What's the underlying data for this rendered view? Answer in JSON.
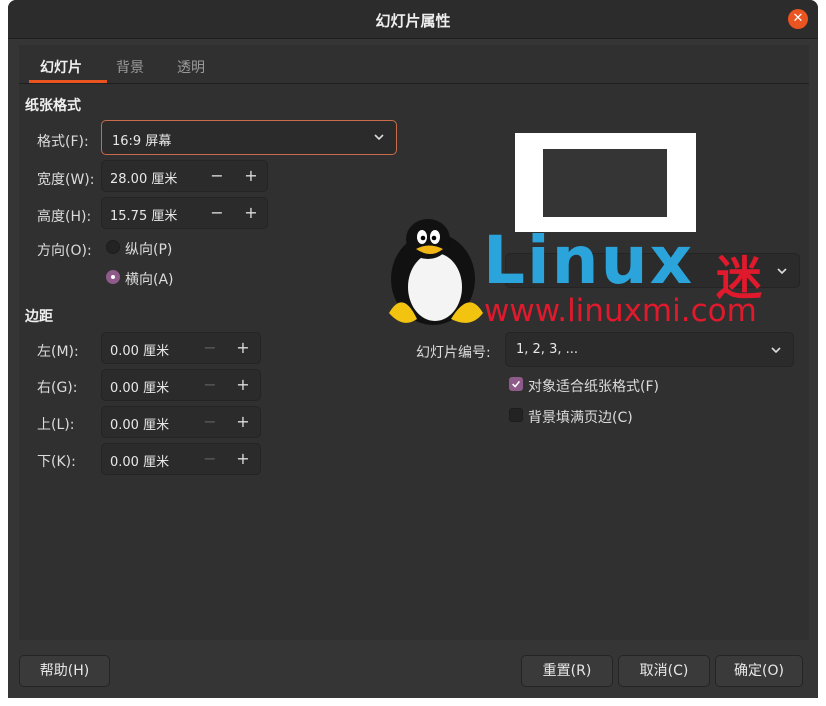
{
  "window": {
    "title": "幻灯片属性"
  },
  "tabs": [
    {
      "label": "幻灯片",
      "active": true
    },
    {
      "label": "背景",
      "active": false
    },
    {
      "label": "透明",
      "active": false
    }
  ],
  "paper_format": {
    "section_label": "纸张格式",
    "format_label": "格式(F):",
    "format_value": "16:9 屏幕",
    "width_label": "宽度(W):",
    "width_value": "28.00 厘米",
    "height_label": "高度(H):",
    "height_value": "15.75 厘米",
    "orientation_label": "方向(O):",
    "portrait_label": "纵向(P)",
    "landscape_label": "横向(A)",
    "orientation_selected": "landscape"
  },
  "margins": {
    "section_label": "边距",
    "left_label": "左(M):",
    "left_value": "0.00 厘米",
    "right_label": "右(G):",
    "right_value": "0.00 厘米",
    "top_label": "上(L):",
    "top_value": "0.00 厘米",
    "bottom_label": "下(K):",
    "bottom_value": "0.00 厘米"
  },
  "spin_glyphs": {
    "minus": "−",
    "plus": "+"
  },
  "layout_settings": {
    "tray_label_partial": "盘(",
    "slide_numbers_label": "幻灯片编号:",
    "slide_numbers_value": "1, 2, 3, ...",
    "fit_object_label": "对象适合纸张格式(F)",
    "fit_object_checked": true,
    "fill_border_label": "背景填满页边(C)",
    "fill_border_checked": false
  },
  "watermark": {
    "brand": "Linux",
    "brand_suffix": "迷",
    "url": "www.linuxmi.com"
  },
  "footer": {
    "help": "帮助(H)",
    "reset": "重置(R)",
    "cancel": "取消(C)",
    "ok": "确定(O)"
  },
  "colors": {
    "accent": "#e95420",
    "check_purple": "#8e5a8a",
    "watermark_blue": "#2aa4db",
    "watermark_red": "#e01a2c"
  },
  "icons": {
    "close": "close-icon",
    "combo": "chevron-down-icon",
    "mascot": "tux-penguin-icon"
  }
}
